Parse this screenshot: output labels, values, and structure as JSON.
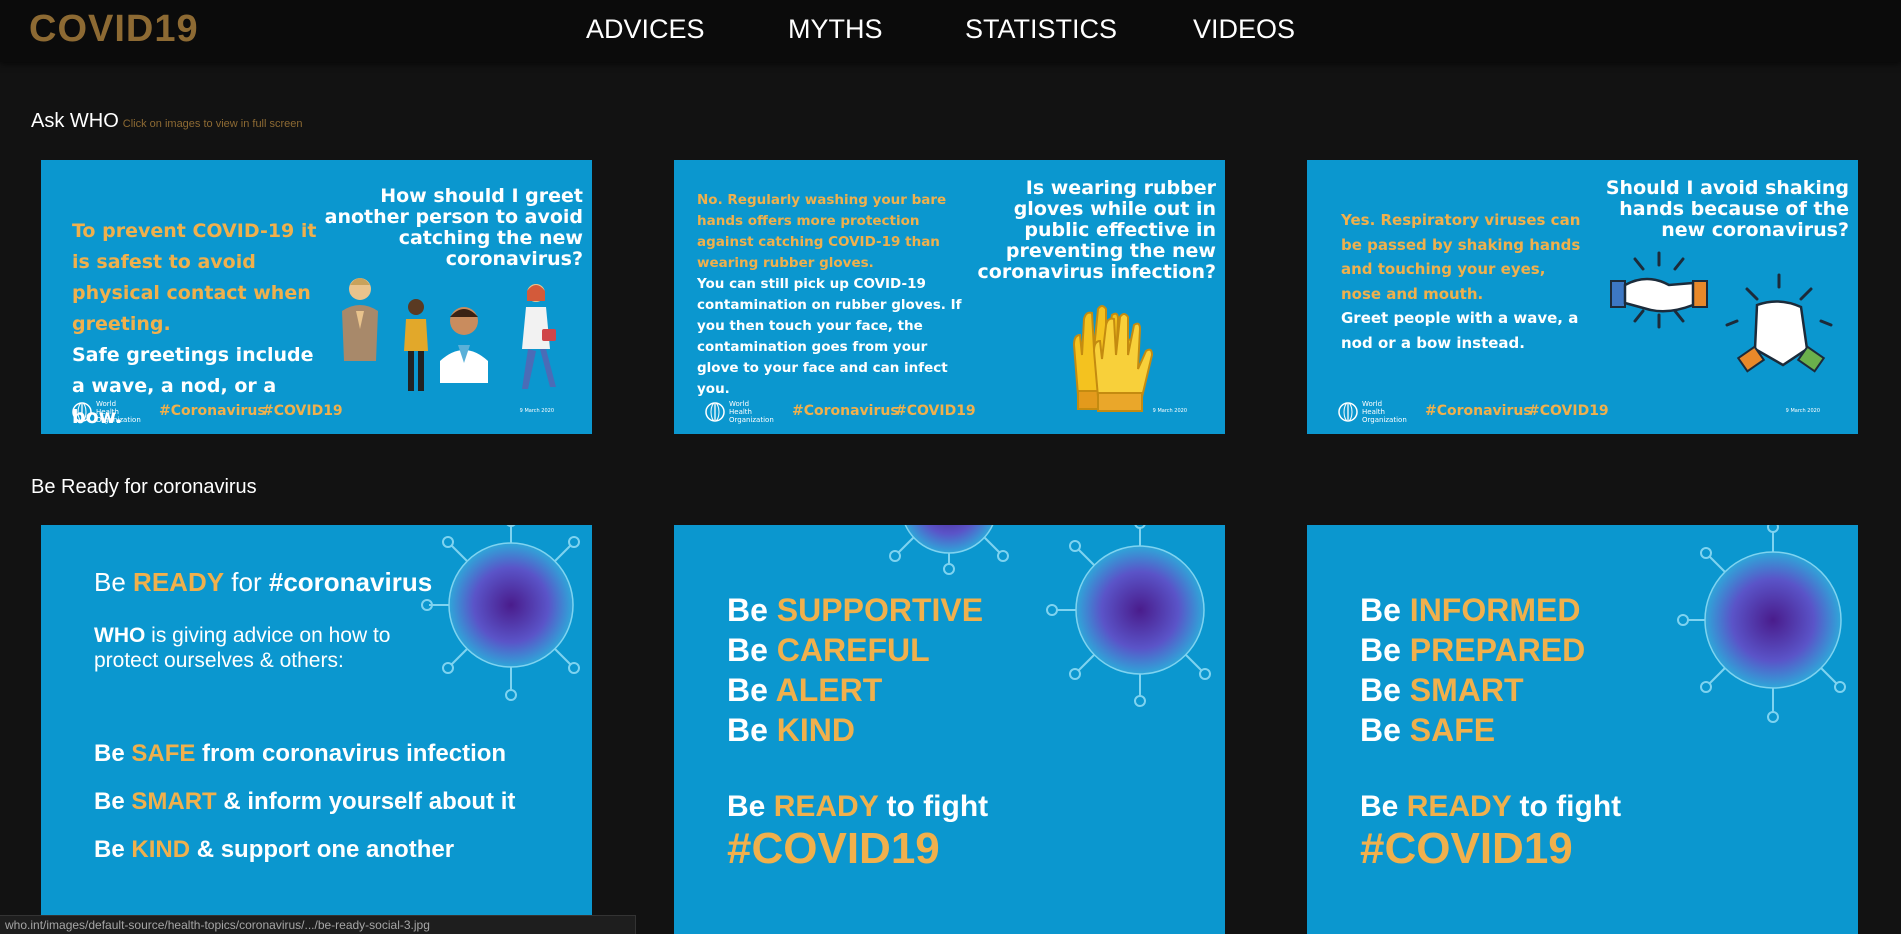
{
  "header": {
    "logo": "COVID19",
    "nav": [
      "ADVICES",
      "MYTHS",
      "STATISTICS",
      "VIDEOS"
    ]
  },
  "sections": {
    "ask_who": {
      "title": "Ask WHO",
      "hint": "Click on images to view in full screen"
    },
    "be_ready": {
      "title": "Be Ready for coronavirus"
    }
  },
  "ask_cards": [
    {
      "question": "How should I greet another person to avoid catching the new coronavirus?",
      "answer_yellow": "To prevent COVID-19 it is safest to avoid physical contact when greeting.",
      "answer_white": "Safe greetings include a wave, a nod, or a bow."
    },
    {
      "question": "Is wearing rubber gloves while out in public effective in preventing the new coronavirus infection?",
      "answer_yellow": "No. Regularly washing your bare hands offers more protection against catching COVID-19 than wearing rubber gloves.",
      "answer_white": "You can still pick up COVID-19 contamination on rubber gloves. If you then touch your face, the contamination goes from your glove to your face and can infect you."
    },
    {
      "question": "Should I avoid shaking hands because of the new coronavirus?",
      "answer_yellow": "Yes. Respiratory viruses can be passed by shaking hands and touching your eyes, nose and mouth.",
      "answer_white": "Greet people with a wave, a nod or a bow instead."
    }
  ],
  "card_footer": {
    "org": "World Health Organization",
    "tag1": "#Coronavirus",
    "tag2": "#COVID19",
    "date": "9 March 2020"
  },
  "ready_cards": {
    "card1": {
      "title_be": "Be",
      "title_ready": "READY",
      "title_for": "for",
      "title_tag": "#coronavirus",
      "intro_who": "WHO",
      "intro_rest": "is giving advice on how to protect ourselves & others:",
      "lines": [
        {
          "be": "Be",
          "key": "SAFE",
          "rest": "from coronavirus infection"
        },
        {
          "be": "Be",
          "key": "SMART",
          "rest": "& inform yourself about it"
        },
        {
          "be": "Be",
          "key": "KIND",
          "rest": "& support one another"
        }
      ]
    },
    "card2": {
      "lines": [
        {
          "be": "Be",
          "key": "SUPPORTIVE"
        },
        {
          "be": "Be",
          "key": "CAREFUL"
        },
        {
          "be": "Be",
          "key": "ALERT"
        },
        {
          "be": "Be",
          "key": "KIND"
        }
      ],
      "fight_be": "Be",
      "fight_ready": "READY",
      "fight_rest": "to fight",
      "hashtag": "#COVID19"
    },
    "card3": {
      "lines": [
        {
          "be": "Be",
          "key": "INFORMED"
        },
        {
          "be": "Be",
          "key": "PREPARED"
        },
        {
          "be": "Be",
          "key": "SMART"
        },
        {
          "be": "Be",
          "key": "SAFE"
        }
      ],
      "fight_be": "Be",
      "fight_ready": "READY",
      "fight_rest": "to fight",
      "hashtag": "#COVID19"
    }
  },
  "status_url": "who.int/images/default-source/health-topics/coronavirus/.../be-ready-social-3.jpg",
  "colors": {
    "card_blue": "#0b97cf",
    "accent_yellow": "#f0b04c",
    "logo_gold": "#8d6a33",
    "background": "#121212"
  }
}
